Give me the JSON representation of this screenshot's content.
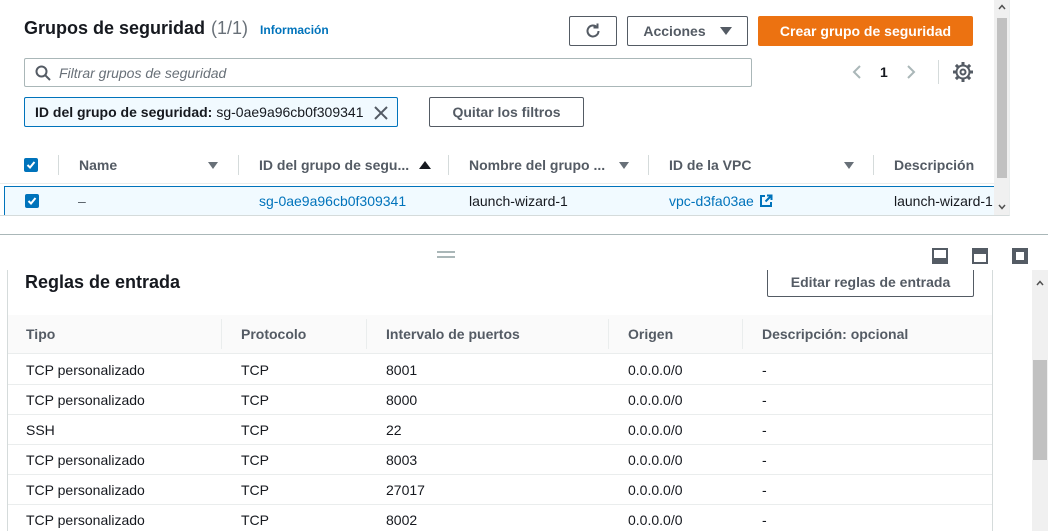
{
  "header": {
    "title": "Grupos de seguridad",
    "count": "(1/1)",
    "info_link": "Información"
  },
  "toolbar": {
    "refresh_icon": "refresh-icon",
    "actions_label": "Acciones",
    "create_label": "Crear grupo de seguridad"
  },
  "search": {
    "placeholder": "Filtrar grupos de seguridad"
  },
  "pagination": {
    "current_page": "1"
  },
  "filter_token": {
    "key": "ID del grupo de seguridad:",
    "value": "sg-0ae9a96cb0f309341"
  },
  "clear_filters_label": "Quitar los filtros",
  "table": {
    "columns": {
      "name": "Name",
      "group_id": "ID del grupo de segu...",
      "group_name": "Nombre del grupo ...",
      "vpc_id": "ID de la VPC",
      "description": "Descripción"
    },
    "rows": [
      {
        "name": "–",
        "group_id": "sg-0ae9a96cb0f309341",
        "group_name": "launch-wizard-1",
        "vpc_id": "vpc-d3fa03ae",
        "description": "launch-wizard-1"
      }
    ]
  },
  "inbound": {
    "title": "Reglas de entrada",
    "edit_label": "Editar reglas de entrada",
    "columns": {
      "type": "Tipo",
      "protocol": "Protocolo",
      "port_range": "Intervalo de puertos",
      "source": "Origen",
      "description": "Descripción: opcional"
    },
    "rows": [
      {
        "type": "TCP personalizado",
        "protocol": "TCP",
        "port": "8001",
        "source": "0.0.0.0/0",
        "description": "-"
      },
      {
        "type": "TCP personalizado",
        "protocol": "TCP",
        "port": "8000",
        "source": "0.0.0.0/0",
        "description": "-"
      },
      {
        "type": "SSH",
        "protocol": "TCP",
        "port": "22",
        "source": "0.0.0.0/0",
        "description": "-"
      },
      {
        "type": "TCP personalizado",
        "protocol": "TCP",
        "port": "8003",
        "source": "0.0.0.0/0",
        "description": "-"
      },
      {
        "type": "TCP personalizado",
        "protocol": "TCP",
        "port": "27017",
        "source": "0.0.0.0/0",
        "description": "-"
      },
      {
        "type": "TCP personalizado",
        "protocol": "TCP",
        "port": "8002",
        "source": "0.0.0.0/0",
        "description": "-"
      }
    ]
  },
  "colors": {
    "primary": "#ec7211",
    "link": "#0073bb",
    "selected_bg": "#f1faff"
  }
}
